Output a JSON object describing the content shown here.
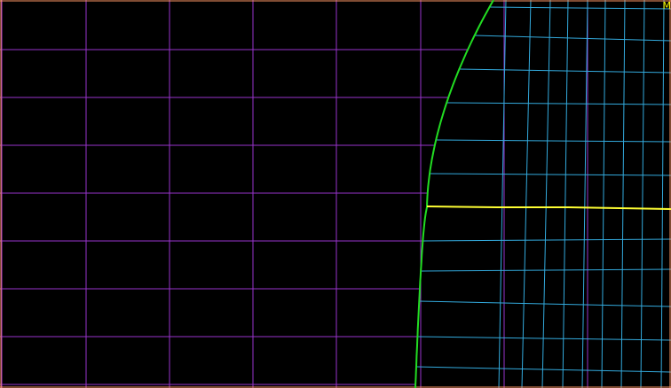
{
  "map": {
    "background_color": "#000000",
    "colors": {
      "frame": "#ff9966",
      "outer_grid": "#9933cc",
      "inner_grid": "#33aadd",
      "boundary": "#22dd22",
      "highlight": "#ffff33"
    },
    "corner_label": "M"
  }
}
